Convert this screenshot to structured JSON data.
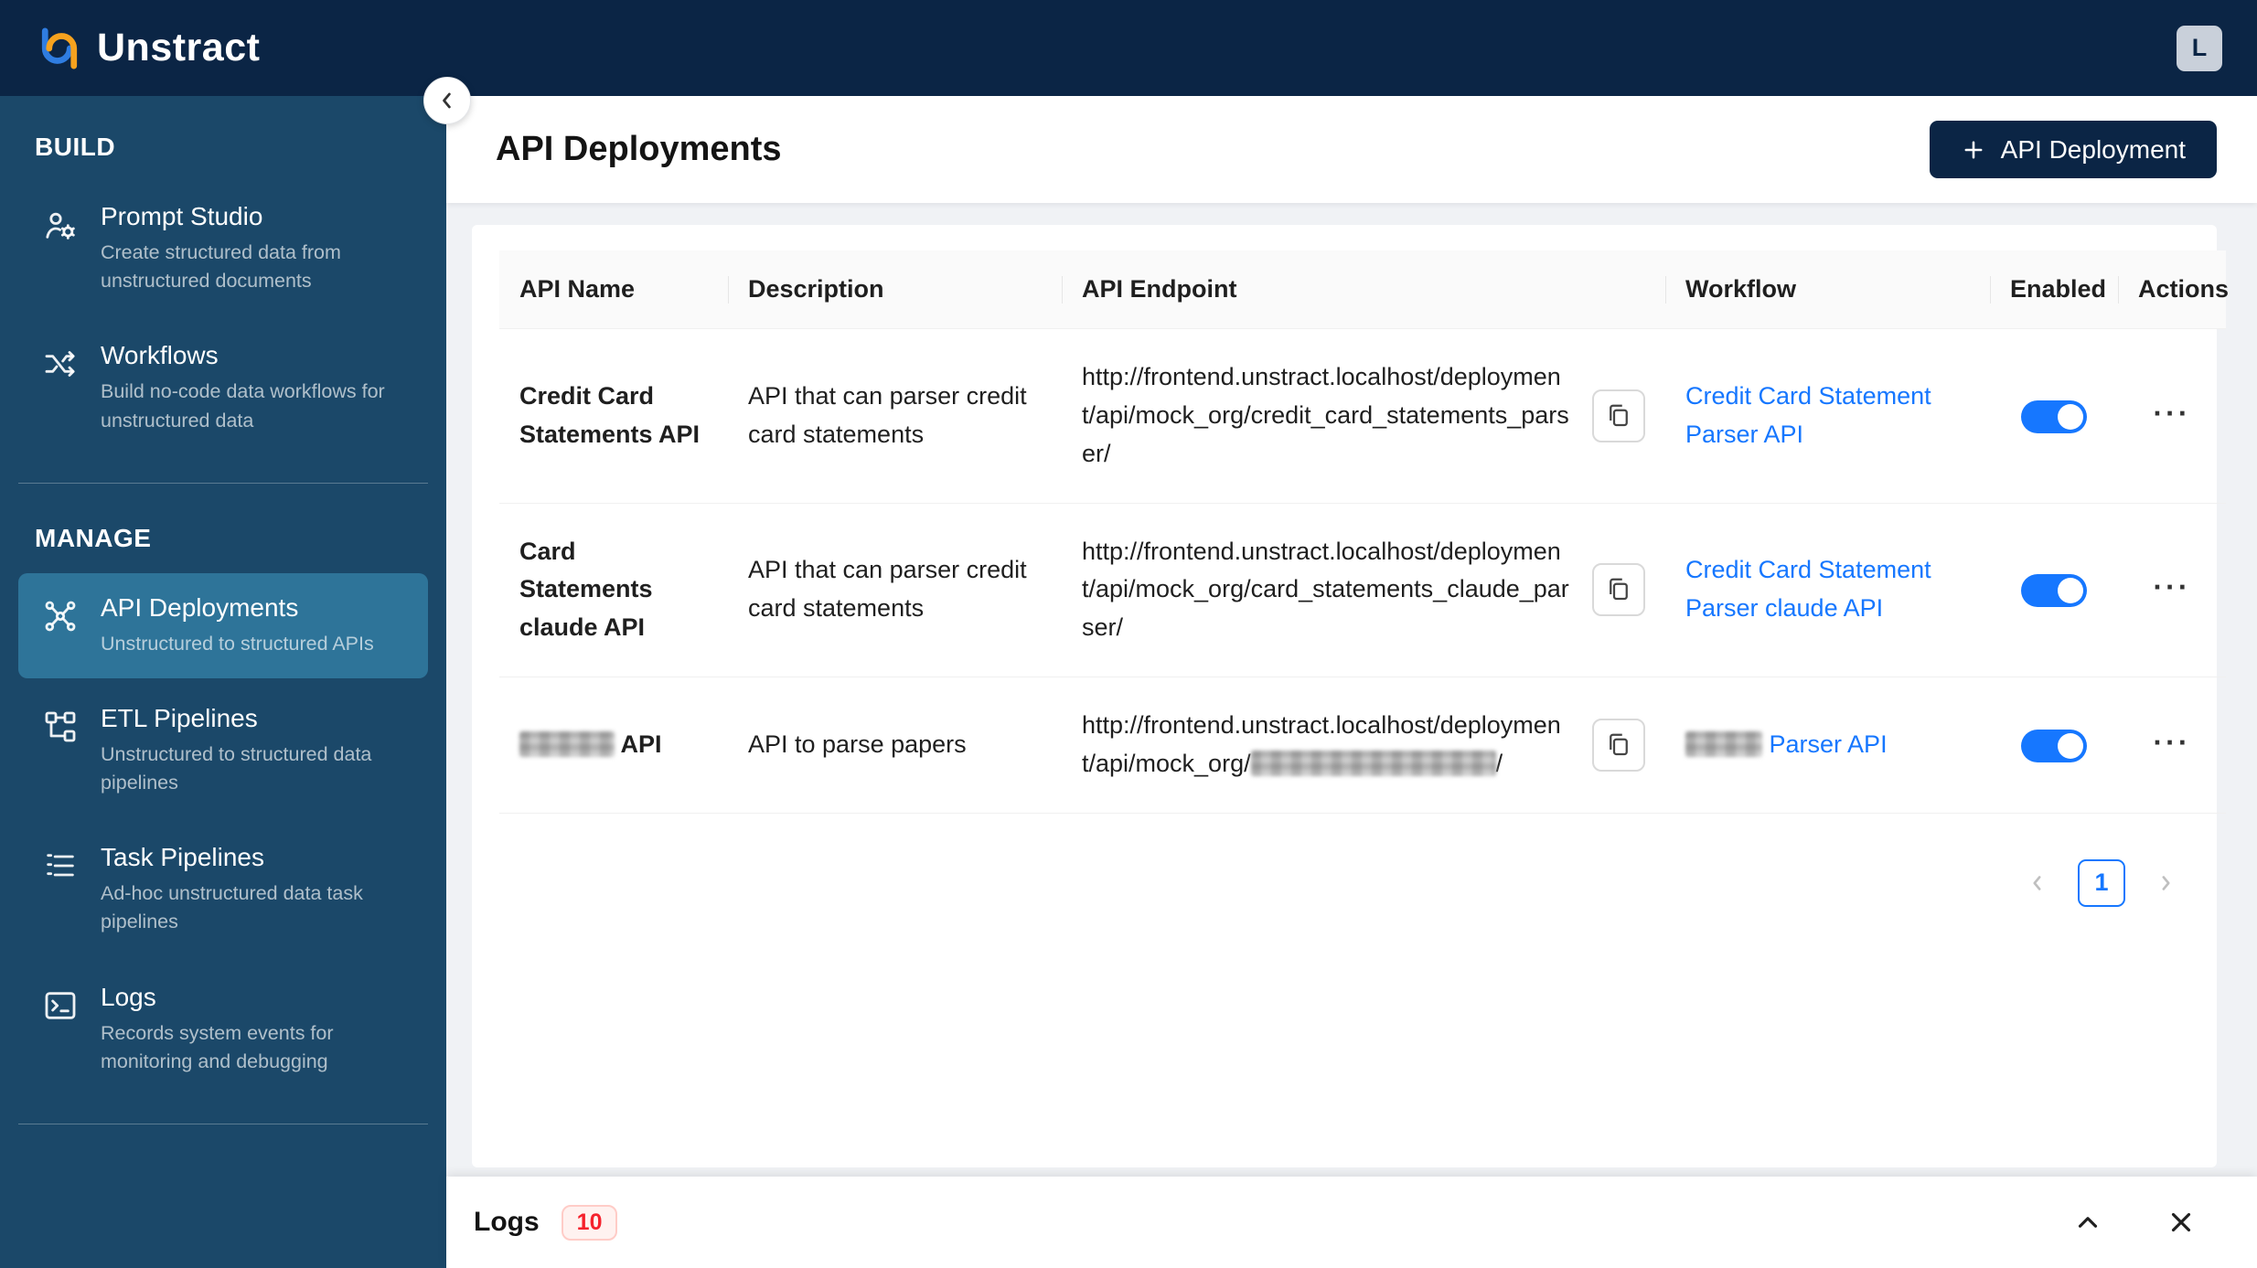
{
  "brand": {
    "name": "Unstract",
    "avatar": "L"
  },
  "sidebar": {
    "sections": [
      {
        "label": "BUILD",
        "items": [
          {
            "title": "Prompt Studio",
            "subtitle": "Create structured data from unstructured documents"
          },
          {
            "title": "Workflows",
            "subtitle": "Build no-code data workflows for unstructured data"
          }
        ]
      },
      {
        "label": "MANAGE",
        "items": [
          {
            "title": "API Deployments",
            "subtitle": "Unstructured to structured APIs",
            "selected": true
          },
          {
            "title": "ETL Pipelines",
            "subtitle": "Unstructured to structured data pipelines"
          },
          {
            "title": "Task Pipelines",
            "subtitle": "Ad-hoc unstructured data task pipelines"
          },
          {
            "title": "Logs",
            "subtitle": "Records system events for monitoring and debugging"
          }
        ]
      }
    ]
  },
  "page": {
    "title": "API Deployments",
    "add_button_label": "API Deployment"
  },
  "table": {
    "columns": [
      "API Name",
      "Description",
      "API Endpoint",
      "Workflow",
      "Enabled",
      "Actions"
    ],
    "more_icon": "···",
    "rows": [
      {
        "name": "Credit Card Statements API",
        "description": "API that can parser credit card statements",
        "endpoint": "http://frontend.unstract.localhost/deployment/api/mock_org/credit_card_statements_parser/",
        "workflow": "Credit Card Statement Parser API",
        "enabled": true
      },
      {
        "name": "Card Statements claude API",
        "description": "API that can parser credit card statements",
        "endpoint": "http://frontend.unstract.localhost/deployment/api/mock_org/card_statements_claude_parser/",
        "workflow": "Credit Card Statement Parser claude API",
        "enabled": true
      },
      {
        "name_suffix": "API",
        "description": "API to parse papers",
        "endpoint_prefix": "http://frontend.unstract.localhost/deployment/api/mock_org/",
        "endpoint_suffix": "/",
        "workflow_suffix": "Parser API",
        "enabled": true
      }
    ]
  },
  "pagination": {
    "current": "1"
  },
  "logs_bar": {
    "label": "Logs",
    "count": "10"
  },
  "colors": {
    "brand_navy": "#0b2545",
    "sidebar_blue": "#1b4869",
    "selected_item": "#2e7499",
    "accent_blue": "#1677ff",
    "badge_red": "#f5222d"
  }
}
